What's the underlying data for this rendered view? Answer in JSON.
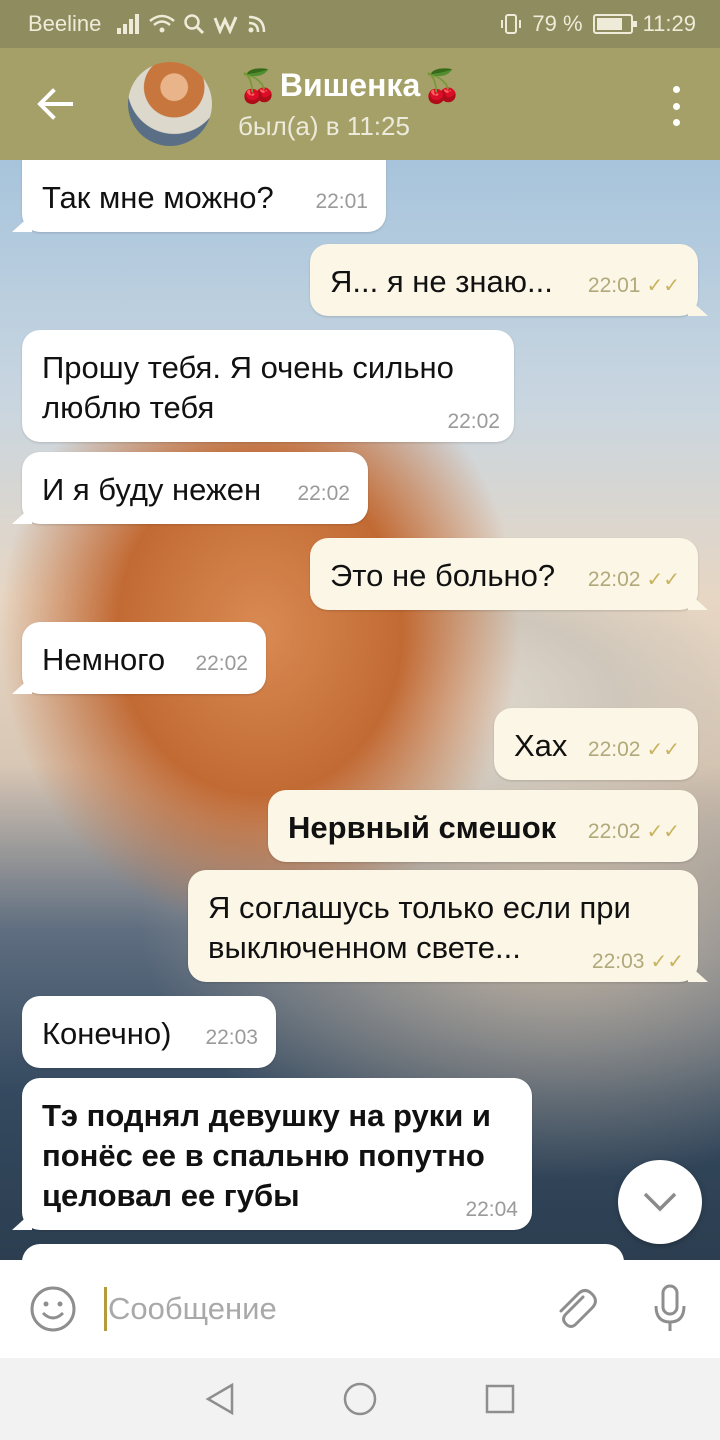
{
  "status_bar": {
    "carrier": "Beeline",
    "battery": "79 %",
    "battery_level": 0.79,
    "time": "11:29"
  },
  "header": {
    "back_icon": "arrow-left-icon",
    "name": "Вишенка",
    "name_emoji": "🍒",
    "status": "был(а) в 11:25",
    "menu_icon": "more-vertical-icon"
  },
  "messages": [
    {
      "dir": "in",
      "text": "Так мне можно?",
      "time": "22:01",
      "bold": false
    },
    {
      "dir": "out",
      "text": "Я... я не знаю...",
      "time": "22:01",
      "bold": false
    },
    {
      "dir": "in",
      "text": "Прошу тебя. Я очень сильно люблю тебя",
      "time": "22:02",
      "bold": false
    },
    {
      "dir": "in",
      "text": "И я буду нежен",
      "time": "22:02",
      "bold": false
    },
    {
      "dir": "out",
      "text": "Это не больно?",
      "time": "22:02",
      "bold": false
    },
    {
      "dir": "in",
      "text": "Немного",
      "time": "22:02",
      "bold": false
    },
    {
      "dir": "out",
      "text": "Хах",
      "time": "22:02",
      "bold": false
    },
    {
      "dir": "out",
      "text": "Нервный смешок",
      "time": "22:02",
      "bold": true
    },
    {
      "dir": "out",
      "text": "Я соглашусь только если при выключенном свете...",
      "time": "22:03",
      "bold": false
    },
    {
      "dir": "in",
      "text": "Конечно)",
      "time": "22:03",
      "bold": false
    },
    {
      "dir": "in",
      "text": "Тэ поднял девушку на руки и понёс ее в спальню попутно целовал ее губы",
      "time": "22:04",
      "bold": true
    }
  ],
  "read_checks": "✓✓",
  "composer": {
    "placeholder": "Сообщение",
    "emoji_icon": "smiley-icon",
    "attach_icon": "paperclip-icon",
    "mic_icon": "microphone-icon"
  },
  "colors": {
    "header": "#a4a067",
    "status_bar": "#8f8c5f",
    "outgoing_bubble": "#fbf6e6",
    "incoming_bubble": "#ffffff",
    "check": "#c8b35e"
  }
}
